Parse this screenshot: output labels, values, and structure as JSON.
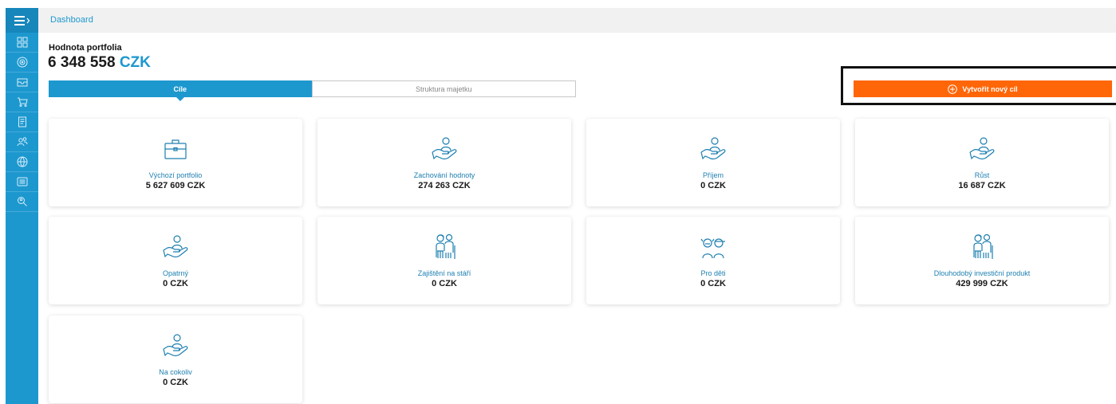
{
  "breadcrumb": "Dashboard",
  "portfolio": {
    "title": "Hodnota portfolia",
    "amount": "6 348 558",
    "currency": "CZK"
  },
  "tabs": [
    {
      "label": "Cíle",
      "active": true
    },
    {
      "label": "Struktura majetku",
      "active": false
    }
  ],
  "create_button": {
    "label": "Vytvořit nový cíl",
    "icon": "plus-circle-icon"
  },
  "sidebar": {
    "toggle_icon": "hamburger-menu-icon",
    "items": [
      {
        "icon": "dashboard-grid-icon"
      },
      {
        "icon": "target-icon"
      },
      {
        "icon": "inbox-icon"
      },
      {
        "icon": "cart-icon"
      },
      {
        "icon": "document-icon"
      },
      {
        "icon": "users-icon"
      },
      {
        "icon": "globe-icon"
      },
      {
        "icon": "list-icon"
      },
      {
        "icon": "search-people-icon"
      }
    ]
  },
  "cards": [
    {
      "label": "Výchozí portfolio",
      "value": "5 627 609 CZK",
      "icon": "briefcase-icon"
    },
    {
      "label": "Zachování hodnoty",
      "value": "274 263 CZK",
      "icon": "hand-person-icon"
    },
    {
      "label": "Příjem",
      "value": "0 CZK",
      "icon": "hand-person-icon"
    },
    {
      "label": "Růst",
      "value": "16 687 CZK",
      "icon": "hand-person-icon"
    },
    {
      "label": "Opatrný",
      "value": "0 CZK",
      "icon": "hand-person-icon"
    },
    {
      "label": "Zajištění na stáří",
      "value": "0 CZK",
      "icon": "elderly-couple-icon"
    },
    {
      "label": "Pro děti",
      "value": "0 CZK",
      "icon": "children-icon"
    },
    {
      "label": "Dlouhodobý investiční produkt",
      "value": "429 999 CZK",
      "icon": "elderly-couple-icon"
    },
    {
      "label": "Na cokoliv",
      "value": "0 CZK",
      "icon": "hand-person-icon"
    }
  ],
  "colors": {
    "accent": "#1d98cf",
    "cta": "#ff6608",
    "topbar": "#f1f1f1"
  }
}
